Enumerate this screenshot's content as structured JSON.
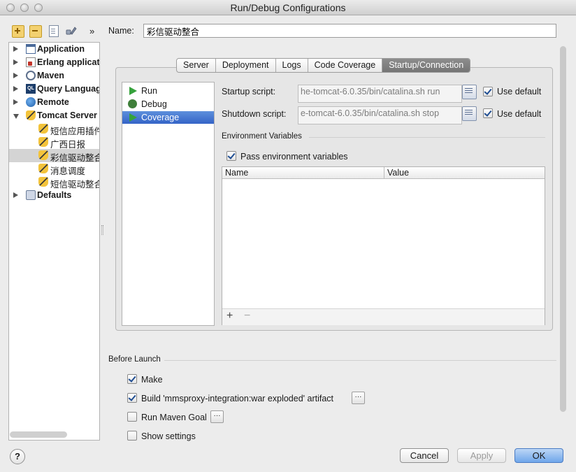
{
  "window": {
    "title": "Run/Debug Configurations"
  },
  "toolbar": {
    "add_icon": "plus-icon",
    "remove_icon": "minus-icon",
    "copy_icon": "copy-icon",
    "settings_icon": "wrench-icon",
    "more": "»"
  },
  "tree": {
    "items": [
      {
        "label": "Application",
        "bold": true,
        "expanded": false,
        "icon": "application-icon"
      },
      {
        "label": "Erlang applicat",
        "bold": true,
        "expanded": false,
        "icon": "erlang-icon"
      },
      {
        "label": "Maven",
        "bold": true,
        "expanded": false,
        "icon": "maven-icon"
      },
      {
        "label": "Query Languag",
        "bold": true,
        "expanded": false,
        "icon": "query-language-icon"
      },
      {
        "label": "Remote",
        "bold": true,
        "expanded": false,
        "icon": "remote-icon"
      },
      {
        "label": "Tomcat Server",
        "bold": true,
        "expanded": true,
        "icon": "tomcat-icon"
      },
      {
        "label": "短信应用插件",
        "bold": false,
        "icon": "tomcat-icon"
      },
      {
        "label": "广西日报",
        "bold": false,
        "icon": "tomcat-icon"
      },
      {
        "label": "彩信驱动整合",
        "bold": false,
        "icon": "tomcat-icon",
        "selected": true
      },
      {
        "label": "消息调度",
        "bold": false,
        "icon": "tomcat-icon"
      },
      {
        "label": "短信驱动整合",
        "bold": false,
        "icon": "tomcat-icon"
      },
      {
        "label": "Defaults",
        "bold": true,
        "expanded": false,
        "icon": "defaults-icon"
      }
    ]
  },
  "config": {
    "name_label": "Name:",
    "name_value": "彩信驱动整合",
    "tabs": [
      "Server",
      "Deployment",
      "Logs",
      "Code Coverage",
      "Startup/Connection"
    ],
    "active_tab": "Startup/Connection",
    "modes": [
      {
        "label": "Run",
        "icon": "run-icon"
      },
      {
        "label": "Debug",
        "icon": "debug-icon"
      },
      {
        "label": "Coverage",
        "icon": "coverage-icon",
        "selected": true
      }
    ],
    "startup": {
      "label": "Startup script:",
      "value": "he-tomcat-6.0.35/bin/catalina.sh run",
      "use_default": "Use default",
      "checked": true
    },
    "shutdown": {
      "label": "Shutdown script:",
      "value": "e-tomcat-6.0.35/bin/catalina.sh stop",
      "use_default": "Use default",
      "checked": true
    },
    "env": {
      "section_label": "Environment Variables",
      "pass_label": "Pass environment variables",
      "pass_checked": true,
      "columns": [
        "Name",
        "Value"
      ],
      "add": "+",
      "remove": "−"
    }
  },
  "before_launch": {
    "title": "Before Launch",
    "items": [
      {
        "label": "Make",
        "checked": true,
        "has_button": false
      },
      {
        "label": "Build 'mmsproxy-integration:war exploded' artifact",
        "checked": true,
        "has_button": true
      },
      {
        "label": "Run Maven Goal",
        "checked": false,
        "has_button": true
      },
      {
        "label": "Show settings",
        "checked": false,
        "has_button": false
      }
    ],
    "dots": "···"
  },
  "buttons": {
    "help": "?",
    "cancel": "Cancel",
    "apply": "Apply",
    "ok": "OK"
  }
}
